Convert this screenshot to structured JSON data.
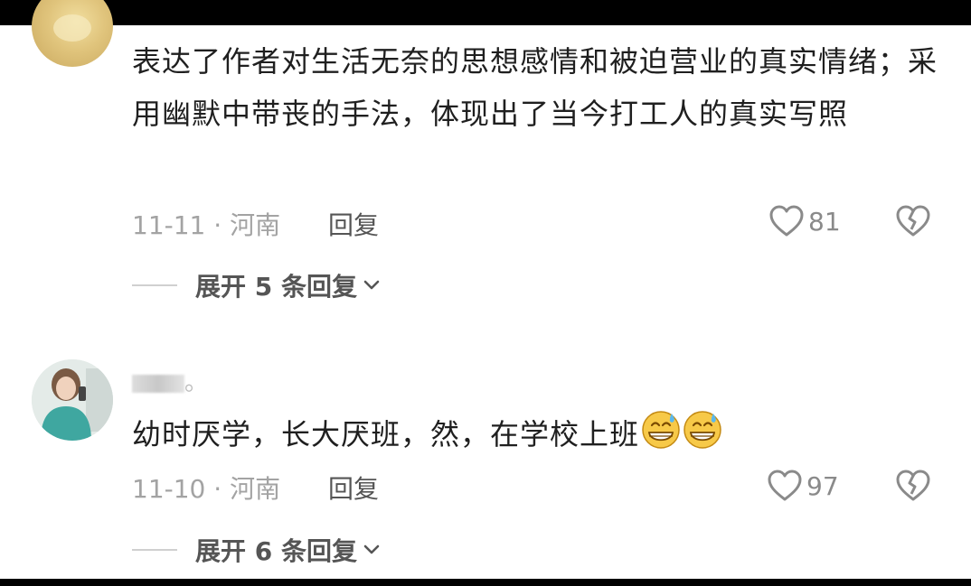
{
  "comments": [
    {
      "text": "表达了作者对生活无奈的思想感情和被迫营业的真实情绪；采用幽默中带丧的手法，体现出了当今打工人的真实写照",
      "date_location": "11-11 · 河南",
      "reply_label": "回复",
      "likes": "81",
      "expand_label": "展开 5 条回复"
    },
    {
      "username": "。",
      "text": "幼时厌学，长大厌班，然，在学校上班",
      "date_location": "11-10 · 河南",
      "reply_label": "回复",
      "likes": "97",
      "expand_label": "展开 6 条回复"
    }
  ],
  "icons": {
    "like": "heart-outline-icon",
    "dislike": "broken-heart-icon",
    "expand": "chevron-down-icon",
    "emoji": "grinning-sweat-emoji-icon"
  },
  "colors": {
    "text": "#1f1f1f",
    "meta": "#a3a3a3",
    "reply": "#555555",
    "icon": "#8a8a8a"
  }
}
